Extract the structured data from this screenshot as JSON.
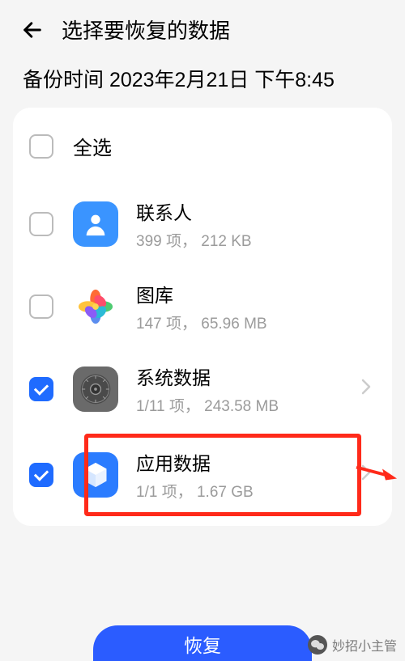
{
  "header": {
    "title": "选择要恢复的数据"
  },
  "backup_time_label": "备份时间 2023年2月21日 下午8:45",
  "select_all_label": "全选",
  "items": [
    {
      "title": "联系人",
      "subtitle": "399 项， 212 KB",
      "checked": false,
      "has_chevron": false
    },
    {
      "title": "图库",
      "subtitle": "147 项， 65.96 MB",
      "checked": false,
      "has_chevron": false
    },
    {
      "title": "系统数据",
      "subtitle": "1/11 项， 243.58 MB",
      "checked": true,
      "has_chevron": true
    },
    {
      "title": "应用数据",
      "subtitle": "1/1 项， 1.67 GB",
      "checked": true,
      "has_chevron": true
    }
  ],
  "restore_button_label": "恢复",
  "footer_text": "妙招小主管"
}
